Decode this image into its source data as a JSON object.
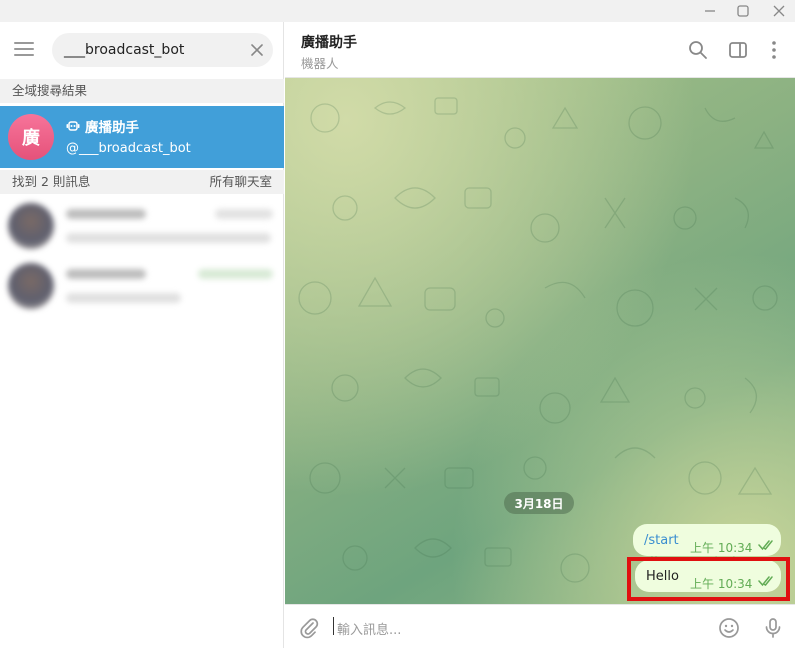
{
  "window": {
    "minimize_icon": "minimize-icon",
    "maximize_icon": "maximize-icon",
    "close_icon": "close-icon"
  },
  "sidebar": {
    "search": {
      "value": "___broadcast_bot"
    },
    "global_results_label": "全域搜尋結果",
    "result": {
      "avatar_letter": "廣",
      "name": "廣播助手",
      "username": "@___broadcast_bot"
    },
    "messages_found_label": "找到 2 則訊息",
    "all_chats_label": "所有聊天室"
  },
  "chat": {
    "title": "廣播助手",
    "subtitle": "機器人",
    "date_label": "3月18日",
    "messages": [
      {
        "text": "/start",
        "time": "上午 10:34"
      },
      {
        "text": "Hello",
        "time": "上午 10:34"
      }
    ],
    "composer_placeholder": "輸入訊息..."
  },
  "colors": {
    "accent": "#419fd9",
    "bubble": "#effdde",
    "time": "#62ac55",
    "highlight": "#e01010"
  }
}
